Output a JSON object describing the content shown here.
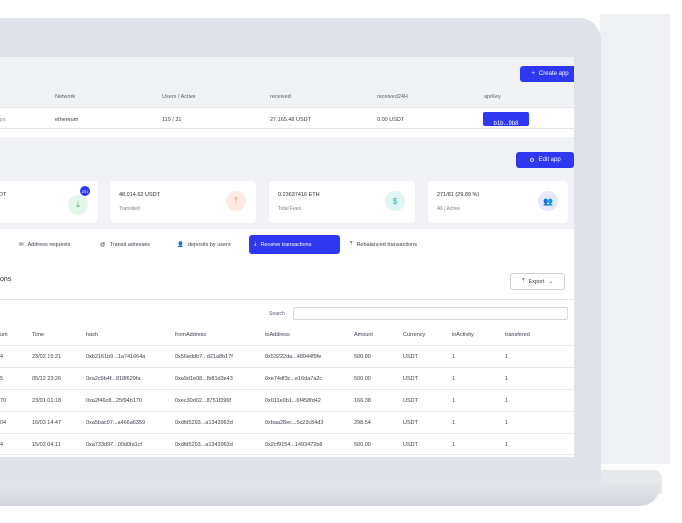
{
  "header": {
    "create_app_label": "Create app",
    "edit_app_label": "Edit app"
  },
  "apps_table": {
    "columns": [
      "Network",
      "Users / Active",
      "received",
      "received24H",
      "apiKey"
    ],
    "row": {
      "name_partial": "ps",
      "network": "ethereum",
      "users_active": "119 / 31",
      "received": "27,165.48 USDT",
      "received24h": "0.00 USDT",
      "apikey": "b1b...9b8"
    }
  },
  "stats": [
    {
      "value": "DT",
      "label": "",
      "icon": "download-icon",
      "badge": "201"
    },
    {
      "value": "48,014.62 USDT",
      "label": "Transited",
      "icon": "upload-icon"
    },
    {
      "value": "0.23637416 ETH",
      "label": "Total Fees",
      "icon": "dollar-icon"
    },
    {
      "value": "271/81 (29.89 %)",
      "label": "All / Active",
      "icon": "users-icon"
    }
  ],
  "tabs": [
    {
      "label": "Address requests",
      "icon": "mail-icon"
    },
    {
      "label": "Transit adresses",
      "icon": "at-icon"
    },
    {
      "label": "deposits by users",
      "icon": "user-icon"
    },
    {
      "label": "Receive transactions",
      "icon": "download-icon",
      "active": true
    },
    {
      "label": "Rebalanced transactions",
      "icon": "upload-icon"
    }
  ],
  "section": {
    "title_partial": "ons",
    "export_label": "Export",
    "search_label": "Search",
    "search_value": ""
  },
  "tx_table": {
    "columns": [
      "um",
      "Time",
      "hash",
      "fromAddress",
      "toAddress",
      "Amount",
      "Currency",
      "inActivity",
      "transfered"
    ],
    "rows": [
      [
        "4",
        "23/02 15:21",
        "0xb2161b9...1a741664a",
        "0x56eddb7...d21a8b17f",
        "0x53222da...48044f9fe",
        "500.80",
        "USDT",
        "1",
        "1"
      ],
      [
        "5",
        "05/12 23:26",
        "0xa2c9b4f...818f629fa",
        "0xa9d1e08...fb81d3e43",
        "0xe74df3c...e16da7a2c",
        "500.00",
        "USDT",
        "1",
        "1"
      ],
      [
        "70",
        "23/01 01:18",
        "0xa2f46c8...25f94b170",
        "0xec30d02...8751f396f",
        "0x011e0b1...6f458fd42",
        "166.38",
        "USDT",
        "1",
        "1"
      ],
      [
        "04",
        "16/03 14:47",
        "0xa5bac97...a466a6359",
        "0xdfd5293...a1343963d",
        "0xbaa28ec...5c23c84d3",
        "298.54",
        "USDT",
        "1",
        "1"
      ],
      [
        "4",
        "15/02 04:11",
        "0xa733d97...00d0fa1cf",
        "0xdfd5293...a1343963d",
        "0x2cf9154...1493472b8",
        "500.00",
        "USDT",
        "1",
        "1"
      ]
    ]
  },
  "colors": {
    "accent": "#2d38f0",
    "download_bg": "#e3f6ea",
    "upload_bg": "#fdebe3",
    "dollar_bg": "#dff6f4",
    "users_bg": "#e6e8fb"
  }
}
